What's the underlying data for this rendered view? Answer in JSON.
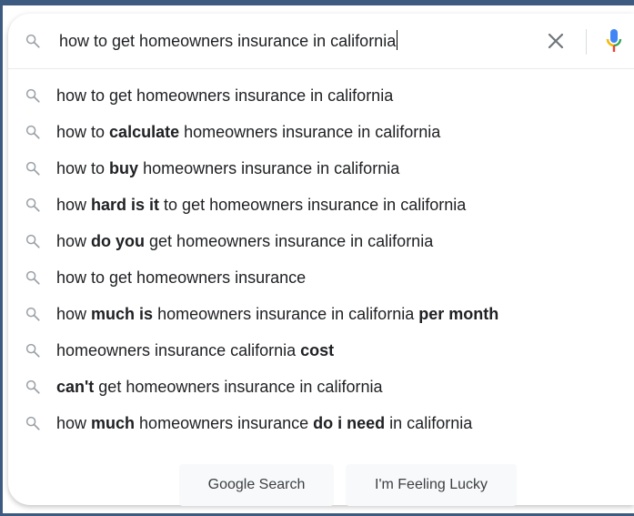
{
  "search": {
    "query": "how to get homeowners insurance in california",
    "icon": "search-icon",
    "clear_icon": "close-icon",
    "mic_icon": "microphone-icon",
    "colors": {
      "mic_blue": "#4285f4",
      "mic_red": "#ea4335",
      "mic_yellow": "#fbbc04",
      "mic_green": "#34a853",
      "icon_gray": "#9aa0a6"
    }
  },
  "suggestions": [
    {
      "parts": [
        {
          "t": "how to get homeowners insurance in california",
          "b": false
        }
      ]
    },
    {
      "parts": [
        {
          "t": "how to ",
          "b": false
        },
        {
          "t": "calculate",
          "b": true
        },
        {
          "t": " homeowners insurance in california",
          "b": false
        }
      ]
    },
    {
      "parts": [
        {
          "t": "how to ",
          "b": false
        },
        {
          "t": "buy",
          "b": true
        },
        {
          "t": " homeowners insurance in california",
          "b": false
        }
      ]
    },
    {
      "parts": [
        {
          "t": "how ",
          "b": false
        },
        {
          "t": "hard is it",
          "b": true
        },
        {
          "t": " to get homeowners insurance in california",
          "b": false
        }
      ]
    },
    {
      "parts": [
        {
          "t": "how ",
          "b": false
        },
        {
          "t": "do you",
          "b": true
        },
        {
          "t": " get homeowners insurance in california",
          "b": false
        }
      ]
    },
    {
      "parts": [
        {
          "t": "how to get homeowners insurance",
          "b": false
        }
      ]
    },
    {
      "parts": [
        {
          "t": "how ",
          "b": false
        },
        {
          "t": "much is",
          "b": true
        },
        {
          "t": " homeowners insurance in california ",
          "b": false
        },
        {
          "t": "per month",
          "b": true
        }
      ]
    },
    {
      "parts": [
        {
          "t": "homeowners insurance california ",
          "b": false
        },
        {
          "t": "cost",
          "b": true
        }
      ]
    },
    {
      "parts": [
        {
          "t": "can't",
          "b": true
        },
        {
          "t": " get homeowners insurance in california",
          "b": false
        }
      ]
    },
    {
      "parts": [
        {
          "t": "how ",
          "b": false
        },
        {
          "t": "much",
          "b": true
        },
        {
          "t": " homeowners insurance ",
          "b": false
        },
        {
          "t": "do i need",
          "b": true
        },
        {
          "t": " in california",
          "b": false
        }
      ]
    }
  ],
  "buttons": {
    "search_label": "Google Search",
    "lucky_label": "I'm Feeling Lucky"
  }
}
